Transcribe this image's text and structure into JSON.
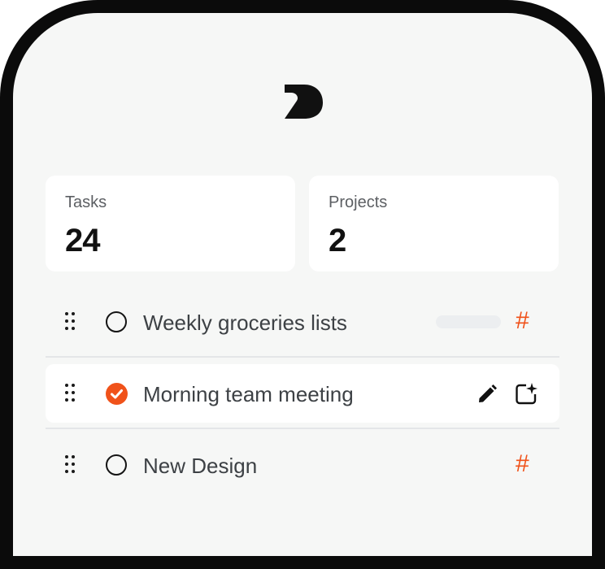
{
  "stats": {
    "tasks": {
      "label": "Tasks",
      "value": "24"
    },
    "projects": {
      "label": "Projects",
      "value": "2"
    }
  },
  "tasks": [
    {
      "title": "Weekly groceries lists",
      "completed": false,
      "project_symbol": "#"
    },
    {
      "title": "Morning team meeting",
      "completed": true
    },
    {
      "title": "New Design",
      "completed": false,
      "project_symbol": "#"
    }
  ],
  "icons": [
    "logo-icon",
    "drag-handle-icon",
    "circle-checkbox-icon",
    "check-icon",
    "hash-icon",
    "pencil-icon",
    "ai-sparkle-icon"
  ],
  "colors": {
    "accent": "#f0521a",
    "background": "#f6f7f6",
    "card": "#ffffff",
    "frame": "#0b0b0b"
  }
}
